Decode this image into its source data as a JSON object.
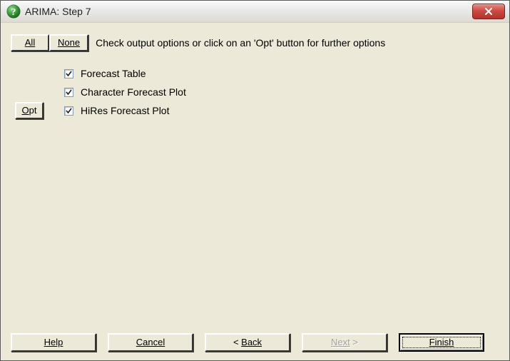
{
  "titlebar": {
    "title": "ARIMA: Step 7"
  },
  "toolbar": {
    "all_label": "All",
    "none_label": "None",
    "instruction": "Check output options or click on an 'Opt' button for further options"
  },
  "options": [
    {
      "opt_button": false,
      "checked": true,
      "label": "Forecast Table"
    },
    {
      "opt_button": false,
      "checked": true,
      "label": "Character Forecast Plot"
    },
    {
      "opt_button": true,
      "checked": true,
      "label": "HiRes Forecast Plot"
    }
  ],
  "opt_button_label": "Opt",
  "footer": {
    "help": "Help",
    "cancel": "Cancel",
    "back": "Back",
    "back_prefix": "< ",
    "next": "Next",
    "next_suffix": " >",
    "finish": "Finish"
  }
}
